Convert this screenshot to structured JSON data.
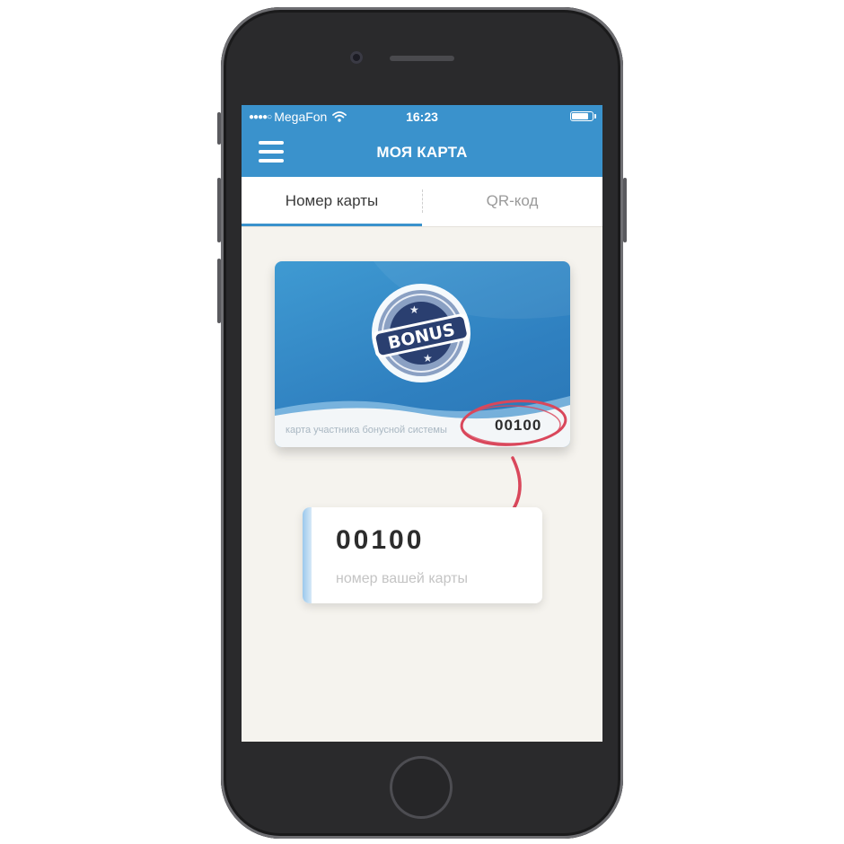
{
  "status_bar": {
    "signal_dots": "●●●●○",
    "carrier": "MegaFon",
    "time": "16:23",
    "battery_level": 0.85
  },
  "nav": {
    "title": "МОЯ КАРТА",
    "menu_icon": "hamburger-menu-icon"
  },
  "tabs": [
    {
      "label": "Номер карты",
      "active": true
    },
    {
      "label": "QR-код",
      "active": false
    }
  ],
  "card": {
    "stamp_text": "BONUS",
    "caption": "карта участника бонусной системы",
    "number": "00100"
  },
  "callout": {
    "number": "00100",
    "label": "номер вашей карты"
  },
  "colors": {
    "primary": "#3a92cc",
    "background": "#f5f3ee",
    "highlight_circle": "#d9475b"
  }
}
